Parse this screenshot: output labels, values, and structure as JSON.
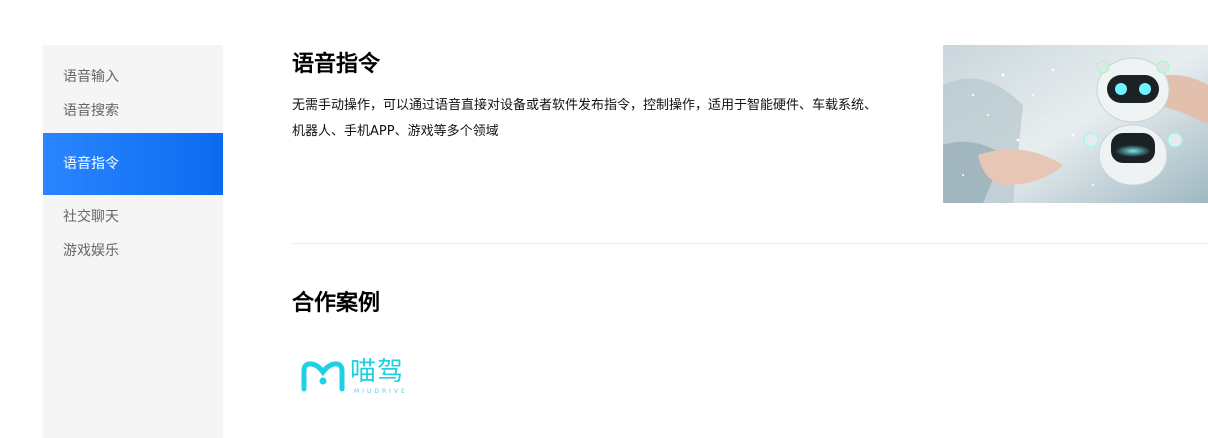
{
  "sidebar": {
    "items": [
      {
        "label": "语音输入"
      },
      {
        "label": "语音搜索"
      },
      {
        "label": "语音指令"
      },
      {
        "label": "社交聊天"
      },
      {
        "label": "游戏娱乐"
      }
    ],
    "active_index": 2
  },
  "main": {
    "title": "语音指令",
    "description": "无需手动操作，可以通过语音直接对设备或者软件发布指令，控制操作，适用于智能硬件、车载系统、机器人、手机APP、游戏等多个领域",
    "hero_image": "robot-hands-image"
  },
  "cases": {
    "title": "合作案例",
    "partners": [
      {
        "name": "喵驾",
        "subtitle": "MIUDRIVE",
        "color": "#1fcfe3"
      }
    ]
  },
  "colors": {
    "accent": "#1677ff",
    "sidebar_bg": "#f5f5f5",
    "logo": "#1fcfe3"
  }
}
